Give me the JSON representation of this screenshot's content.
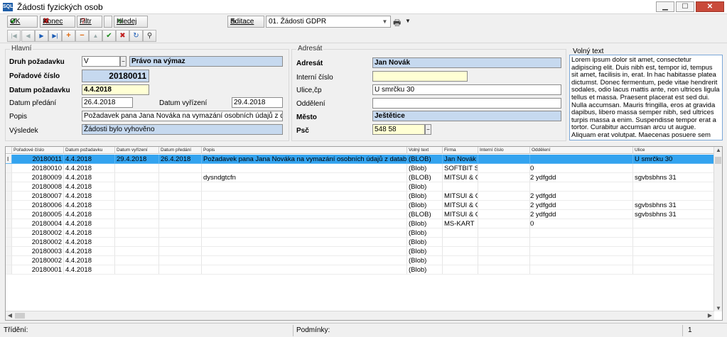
{
  "window": {
    "app_icon_text": "SQL",
    "title": "Žádosti fyzických osob"
  },
  "toolbar": {
    "ok_label": "OK",
    "konec_label": "Konec",
    "filtr_label": "Filtr",
    "hledej_label": "Hledej",
    "editace_label": "Editace",
    "view_select_value": "01. Žádosti GDPR"
  },
  "form": {
    "hlavni": {
      "title": "Hlavní",
      "druh_label": "Druh požadavku",
      "druh_code": "V",
      "druh_text": "Právo na výmaz",
      "poradove_label": "Pořadové číslo",
      "poradove_value": "20180011",
      "datum_pozadavku_label": "Datum požadavku",
      "datum_pozadavku_value": "4.4.2018",
      "datum_predani_label": "Datum předání",
      "datum_predani_value": "26.4.2018",
      "datum_vyrizeni_label": "Datum vyřízení",
      "datum_vyrizeni_value": "29.4.2018",
      "popis_label": "Popis",
      "popis_value": "Požadavek pana Jana Nováka na vymazání osobních údajů z databáze",
      "vysledek_label": "Výsledek",
      "vysledek_value": "Žádosti bylo vyhověno"
    },
    "adresat": {
      "title": "Adresát",
      "adresat_label": "Adresát",
      "adresat_value": "Jan Novák",
      "interni_label": "Interní číslo",
      "interni_value": "",
      "ulice_label": "Ulice,čp",
      "ulice_value": "U smrčku 30",
      "oddeleni_label": "Oddělení",
      "oddeleni_value": "",
      "mesto_label": "Město",
      "mesto_value": "Ještětice",
      "psc_label": "Psč",
      "psc_value": "548 58"
    },
    "volny_text": {
      "title": "Volný text",
      "value": "Lorem ipsum dolor sit amet, consectetur adipiscing elit. Duis nibh est, tempor id, tempus sit amet, facilisis in, erat. In hac habitasse platea dictumst. Donec fermentum, pede vitae hendrerit sodales, odio lacus mattis ante, non ultrices ligula tellus et massa. Praesent placerat est sed dui. Nulla accumsan. Mauris fringilla, eros at gravida dapibus, libero massa semper nibh, sed ultrices turpis massa a enim. Suspendisse tempor erat a tortor. Curabitur accumsan arcu ut augue. Aliquam erat volutpat. Maecenas posuere sem vitae elit."
    }
  },
  "grid": {
    "columns": [
      "Pořadové číslo",
      "Datum požadavku",
      "Datum vyřízení",
      "Datum předání",
      "Popis",
      "Volný text",
      "Firma",
      "Interní číslo",
      "Oddělení",
      "Ulice"
    ],
    "row_indicator": "I",
    "rows": [
      [
        "20180011",
        "4.4.2018",
        "29.4.2018",
        "26.4.2018",
        "Požadavek pana Jana Nováka na vymazání osobních údajů z databáze",
        "(BLOB)",
        "Jan Novák",
        "",
        "",
        "U smrčku 30"
      ],
      [
        "20180010",
        "4.4.2018",
        "",
        "",
        "",
        "(Blob)",
        "SOFTBIT SC",
        "",
        "0",
        ""
      ],
      [
        "20180009",
        "4.4.2018",
        "",
        "",
        "dysndgtcfn",
        "(BLOB)",
        "MITSUI & CC",
        "",
        "2 ydfgdd",
        "sgvbsbhns 31"
      ],
      [
        "20180008",
        "4.4.2018",
        "",
        "",
        "",
        "(Blob)",
        "",
        "",
        "",
        ""
      ],
      [
        "20180007",
        "4.4.2018",
        "",
        "",
        "",
        "(Blob)",
        "MITSUI & CC",
        "",
        "2 ydfgdd",
        ""
      ],
      [
        "20180006",
        "4.4.2018",
        "",
        "",
        "",
        "(Blob)",
        "MITSUI & CC",
        "",
        "2 ydfgdd",
        "sgvbsbhns 31"
      ],
      [
        "20180005",
        "4.4.2018",
        "",
        "",
        "",
        "(BLOB)",
        "MITSUI & CC",
        "",
        "2 ydfgdd",
        "sgvbsbhns 31"
      ],
      [
        "20180004",
        "4.4.2018",
        "",
        "",
        "",
        "(Blob)",
        "MS-KART",
        "",
        "0",
        ""
      ],
      [
        "20180002",
        "4.4.2018",
        "",
        "",
        "",
        "(Blob)",
        "",
        "",
        "",
        ""
      ],
      [
        "20180002",
        "4.4.2018",
        "",
        "",
        "",
        "(Blob)",
        "",
        "",
        "",
        ""
      ],
      [
        "20180003",
        "4.4.2018",
        "",
        "",
        "",
        "(Blob)",
        "",
        "",
        "",
        ""
      ],
      [
        "20180002",
        "4.4.2018",
        "",
        "",
        "",
        "(Blob)",
        "",
        "",
        "",
        ""
      ],
      [
        "20180001",
        "4.4.2018",
        "",
        "",
        "",
        "(Blob)",
        "",
        "",
        "",
        ""
      ]
    ],
    "selected_row": 0
  },
  "statusbar": {
    "trideni_label": "Třídění:",
    "podminky_label": "Podmínky:",
    "count": "1"
  },
  "colors": {
    "selected_row": "#33a3ef",
    "readonly_field": "#c6d9ef",
    "required_field": "#ffffd4"
  }
}
